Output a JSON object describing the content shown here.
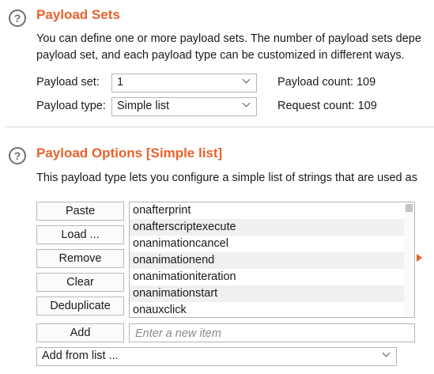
{
  "payload_sets": {
    "help_icon": "question-mark-icon",
    "title": "Payload Sets",
    "description_line1": "You can define one or more payload sets. The number of payload sets depe",
    "description_line2": "payload set, and each payload type can be customized in different ways.",
    "payload_set_label": "Payload set:",
    "payload_set_value": "1",
    "payload_type_label": "Payload type:",
    "payload_type_value": "Simple list",
    "payload_count": "Payload count: 109",
    "request_count": "Request count: 109"
  },
  "payload_options": {
    "help_icon": "question-mark-icon",
    "title": "Payload Options [Simple list]",
    "description": "This payload type lets you configure a simple list of strings that are used as",
    "buttons": {
      "paste": "Paste",
      "load": "Load ...",
      "remove": "Remove",
      "clear": "Clear",
      "deduplicate": "Deduplicate",
      "add": "Add"
    },
    "items": [
      "onafterprint",
      "onafterscriptexecute",
      "onanimationcancel",
      "onanimationend",
      "onanimationiteration",
      "onanimationstart",
      "onauxclick"
    ],
    "new_item_placeholder": "Enter a new item",
    "add_from_list": "Add from list ..."
  },
  "colors": {
    "accent": "#e8622c",
    "help_icon": "#6f6f6f",
    "alt_row": "#f0f0f0"
  }
}
